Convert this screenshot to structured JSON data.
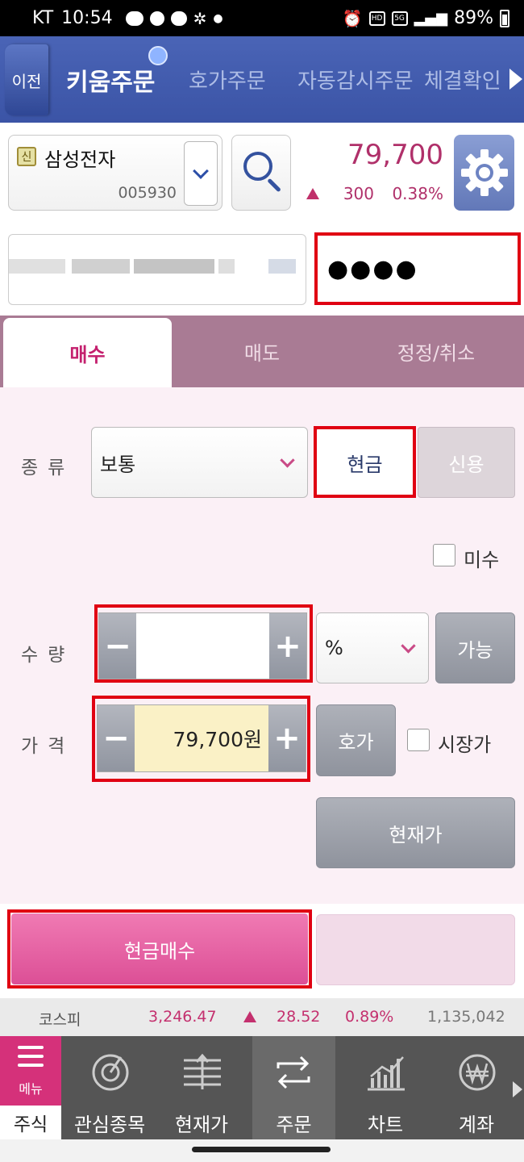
{
  "status_bar": {
    "carrier": "KT",
    "time": "10:54",
    "battery": "89%"
  },
  "top_nav": {
    "back_label": "이전",
    "tabs": [
      {
        "label": "키움주문",
        "active": true
      },
      {
        "label": "호가주문",
        "active": false
      },
      {
        "label": "자동감시주문",
        "active": false
      },
      {
        "label": "체결확인",
        "active": false
      }
    ]
  },
  "stock": {
    "badge": "신",
    "name": "삼성전자",
    "code": "005930",
    "price": "79,700",
    "change": "300",
    "change_pct": "0.38%",
    "up_color": "#b0306a"
  },
  "account": {
    "password_mask": "●●●●"
  },
  "order_tabs": [
    {
      "label": "매수",
      "active": true
    },
    {
      "label": "매도",
      "active": false
    },
    {
      "label": "정정/취소",
      "active": false
    }
  ],
  "form": {
    "type_label": "종류",
    "type_value": "보통",
    "cash_label": "현금",
    "credit_label": "신용",
    "misu_label": "미수",
    "qty_label": "수량",
    "qty_value": "",
    "qty_unit": "%",
    "available_label": "가능",
    "price_label": "가격",
    "price_value": "79,700원",
    "hoga_label": "호가",
    "market_label": "시장가",
    "current_price_label": "현재가"
  },
  "action": {
    "buy_label": "현금매수"
  },
  "ticker": {
    "name": "코스피",
    "value": "3,246.47",
    "change": "28.52",
    "pct": "0.89%",
    "volume": "1,135,042"
  },
  "bottom_nav": {
    "menu_label": "메뉴",
    "menu_sub": "주식",
    "items": [
      {
        "label": "관심종목",
        "icon": "watchlist-icon",
        "active": false
      },
      {
        "label": "현재가",
        "icon": "current-price-icon",
        "active": false
      },
      {
        "label": "주문",
        "icon": "order-icon",
        "active": true
      },
      {
        "label": "차트",
        "icon": "chart-icon",
        "active": false
      },
      {
        "label": "계좌",
        "icon": "account-won-icon",
        "active": false
      }
    ]
  },
  "colors": {
    "highlight": "#e00012",
    "brand_nav": "#3b54a6",
    "buy_pink": "#dc4f96"
  }
}
